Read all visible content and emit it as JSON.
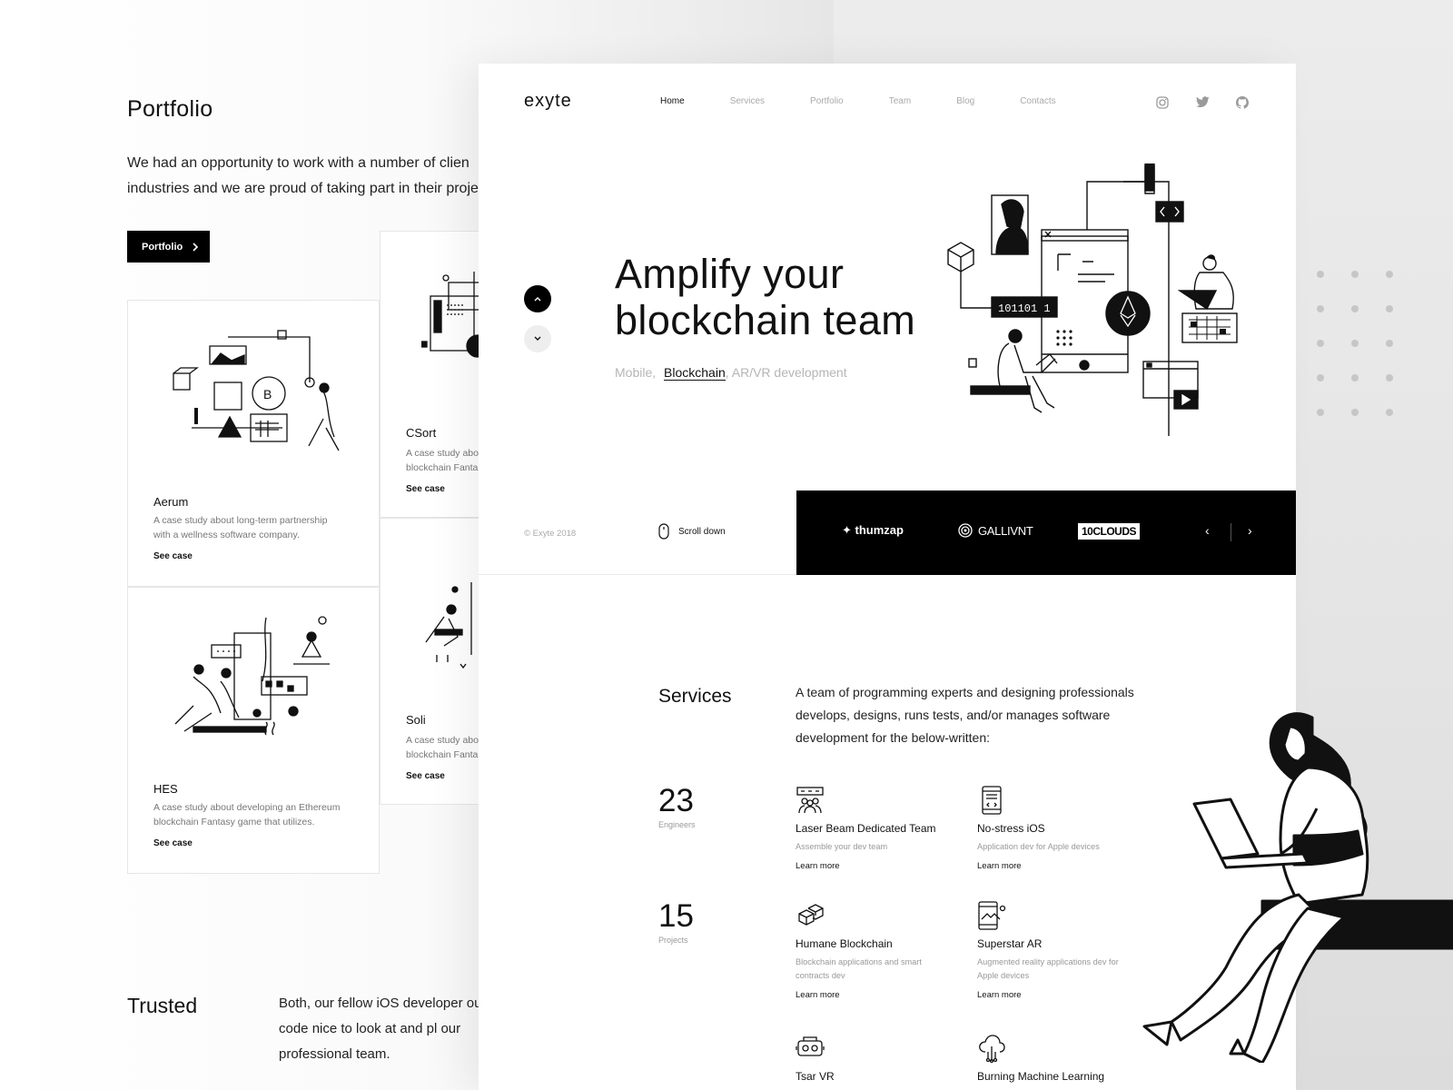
{
  "back_page": {
    "portfolio_title": "Portfolio",
    "portfolio_text": "We had an opportunity to work with a number of clien industries and we are proud of taking part in their proje",
    "portfolio_text_line1": "We had an opportunity to work with a number of clien",
    "portfolio_text_line2": "industries and we are proud of taking part in their proje",
    "portfolio_button": "Portfolio",
    "cards": [
      {
        "title": "Aerum",
        "desc": "A case study about long-term partnership with a wellness software company.",
        "link": "See case"
      },
      {
        "title": "CSort",
        "desc": "A case study abo blockchain Fanta",
        "link": "See case"
      },
      {
        "title": "HES",
        "desc": "A case study about developing an Ethereum blockchain Fantasy game that utilizes.",
        "link": "See case"
      },
      {
        "title": "Soli",
        "desc": "A case study abo blockchain Fanta",
        "link": "See case"
      }
    ],
    "trusted_title": "Trusted",
    "trusted_text": "Both, our fellow iOS developer our code nice to look at and pl our professional team."
  },
  "header": {
    "logo": "exyte",
    "nav": [
      "Home",
      "Services",
      "Portfolio",
      "Team",
      "Blog",
      "Contacts"
    ],
    "active_nav": "Home",
    "social_icons": [
      "instagram-icon",
      "twitter-icon",
      "github-icon"
    ]
  },
  "hero": {
    "title_line1": "Amplify your",
    "title_line2": "blockchain team",
    "sub_before": "Mobile,",
    "sub_highlight": "Blockchain",
    "sub_after": ", AR/VR development",
    "binary_label": "101101 1",
    "code_label": "< / >"
  },
  "strip": {
    "copyright": "© Exyte 2018",
    "scroll_label": "Scroll down",
    "clients": [
      "thumzap",
      "GALLIVNT",
      "10CLOUDS"
    ],
    "prev": "‹",
    "next": "›"
  },
  "services": {
    "title": "Services",
    "intro": "A team of programming experts and designing professionals develops, designs, runs tests, and/or manages software development for the below-written:",
    "stats": [
      {
        "value": "23",
        "label": "Engineers"
      },
      {
        "value": "15",
        "label": "Projects"
      }
    ],
    "items": [
      {
        "icon": "team-icon",
        "title": "Laser Beam Dedicated Team",
        "desc": "Assemble your dev team",
        "link": "Learn more"
      },
      {
        "icon": "ios-icon",
        "title": "No-stress iOS",
        "desc": "Application dev for Apple devices",
        "link": "Learn more"
      },
      {
        "icon": "blockchain-icon",
        "title": "Humane Blockchain",
        "desc": "Blockchain applications and smart contracts dev",
        "link": "Learn more"
      },
      {
        "icon": "ar-icon",
        "title": "Superstar AR",
        "desc": "Augmented reality applications dev for Apple devices",
        "link": "Learn more"
      },
      {
        "icon": "vr-icon",
        "title": "Tsar VR",
        "desc": "",
        "link": ""
      },
      {
        "icon": "ml-icon",
        "title": "Burning Machine Learning",
        "desc": "",
        "link": ""
      }
    ]
  },
  "colors": {
    "accent": "#000000",
    "muted_text": "#999999",
    "background_right": "#e6e6e6"
  }
}
